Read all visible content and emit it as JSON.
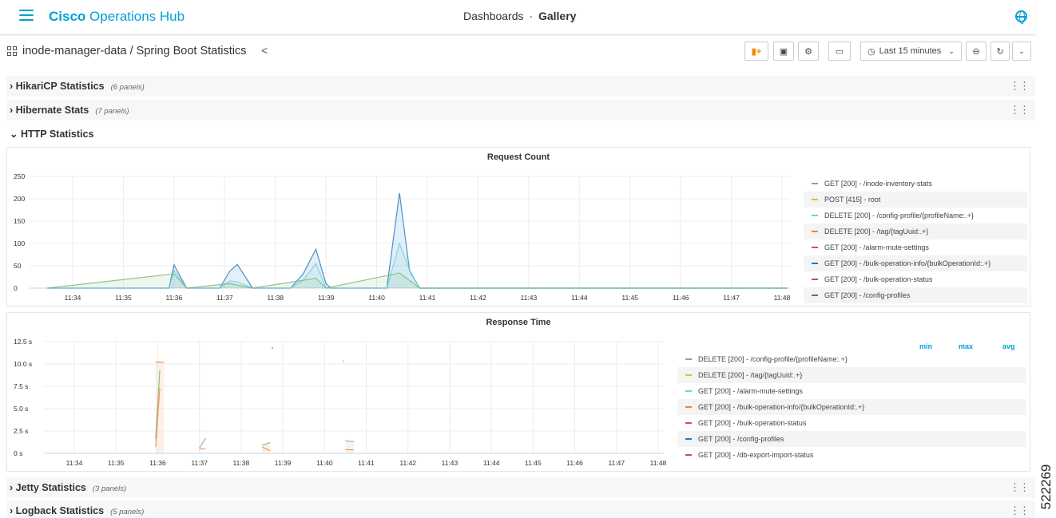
{
  "header": {
    "brand_bold": "Cisco",
    "brand_rest": " Operations Hub",
    "crumb_parent": "Dashboards",
    "crumb_sep": "·",
    "crumb_current": "Gallery"
  },
  "dashboard": {
    "title": "inode-manager-data / Spring Boot Statistics",
    "time_range": "Last 15 minutes"
  },
  "rows": [
    {
      "title": "HikariCP Statistics",
      "count": "(6 panels)",
      "collapsed": true
    },
    {
      "title": "Hibernate Stats",
      "count": "(7 panels)",
      "collapsed": true
    },
    {
      "title": "HTTP Statistics",
      "count": "",
      "collapsed": false
    },
    {
      "title": "Jetty Statistics",
      "count": "(3 panels)",
      "collapsed": true
    },
    {
      "title": "Logback Statistics",
      "count": "(5 panels)",
      "collapsed": true
    }
  ],
  "request_count": {
    "title": "Request Count",
    "legend": [
      {
        "name": "GET [200] - /inode-inventory-stats",
        "color": "#7eb26d"
      },
      {
        "name": "POST [415] - root",
        "color": "#eab839"
      },
      {
        "name": "DELETE [200] - /config-profile/{profileName:.+}",
        "color": "#6ed0e0"
      },
      {
        "name": "DELETE [200] - /tag/{tagUuid:.+}",
        "color": "#ef843c"
      },
      {
        "name": "GET [200] - /alarm-mute-settings",
        "color": "#e24d42"
      },
      {
        "name": "GET [200] - /bulk-operation-info/{bulkOperationId:.+}",
        "color": "#1f78c1"
      },
      {
        "name": "GET [200] - /bulk-operation-status",
        "color": "#ba43a9"
      },
      {
        "name": "GET [200] - /config-profiles",
        "color": "#705da0"
      }
    ]
  },
  "response_time": {
    "title": "Response Time",
    "legend_headers": [
      "min",
      "max",
      "avg"
    ],
    "legend": [
      {
        "name": "DELETE [200] - /config-profile/{profileName:.+}",
        "color": "#7eb26d"
      },
      {
        "name": "DELETE [200] - /tag/{tagUuid:.+}",
        "color": "#eab839"
      },
      {
        "name": "GET [200] - /alarm-mute-settings",
        "color": "#6ed0e0"
      },
      {
        "name": "GET [200] - /bulk-operation-info/{bulkOperationId:.+}",
        "color": "#ef843c"
      },
      {
        "name": "GET [200] - /bulk-operation-status",
        "color": "#e24d42"
      },
      {
        "name": "GET [200] - /config-profiles",
        "color": "#1f78c1"
      },
      {
        "name": "GET [200] - /db-export-import-status",
        "color": "#ba43a9"
      }
    ]
  },
  "chart_data": [
    {
      "type": "area",
      "title": "Request Count",
      "x": [
        "11:34",
        "11:35",
        "11:36",
        "11:37",
        "11:38",
        "11:39",
        "11:40",
        "11:41",
        "11:42",
        "11:43",
        "11:44",
        "11:45",
        "11:46",
        "11:47",
        "11:48"
      ],
      "ylim": [
        0,
        250
      ],
      "yticks": [
        "0",
        "50",
        "100",
        "150",
        "200",
        "250"
      ],
      "grid": true,
      "legend_position": "right",
      "series": [
        {
          "name": "GET [200] - /bulk-operation-info/{bulkOperationId:.+}",
          "color": "#1f78c1",
          "points": [
            [
              "11:33.5",
              0
            ],
            [
              "11:35.9",
              0
            ],
            [
              "11:36.0",
              52
            ],
            [
              "11:36.25",
              0
            ],
            [
              "11:36.9",
              0
            ],
            [
              "11:37.1",
              38
            ],
            [
              "11:37.25",
              53
            ],
            [
              "11:37.55",
              0
            ],
            [
              "11:38.3",
              0
            ],
            [
              "11:38.55",
              32
            ],
            [
              "11:38.8",
              87
            ],
            [
              "11:39.0",
              10
            ],
            [
              "11:39.1",
              0
            ],
            [
              "11:40.2",
              0
            ],
            [
              "11:40.45",
              213
            ],
            [
              "11:40.65",
              38
            ],
            [
              "11:40.85",
              0
            ],
            [
              "11:48.1",
              0
            ]
          ]
        },
        {
          "name": "DELETE [200] - /config-profile/{profileName:.+}",
          "color": "#6ed0e0",
          "points": [
            [
              "11:33.5",
              0
            ],
            [
              "11:35.9",
              0
            ],
            [
              "11:36.0",
              40
            ],
            [
              "11:36.25",
              0
            ],
            [
              "11:36.9",
              0
            ],
            [
              "11:37.1",
              16
            ],
            [
              "11:37.25",
              14
            ],
            [
              "11:37.55",
              0
            ],
            [
              "11:38.3",
              0
            ],
            [
              "11:38.55",
              18
            ],
            [
              "11:38.8",
              55
            ],
            [
              "11:39.0",
              0
            ],
            [
              "11:40.2",
              0
            ],
            [
              "11:40.45",
              100
            ],
            [
              "11:40.65",
              40
            ],
            [
              "11:40.85",
              0
            ],
            [
              "11:48.1",
              0
            ]
          ]
        },
        {
          "name": "GET [200] - /inode-inventory-stats",
          "color": "#7eb26d",
          "points": [
            [
              "11:33.5",
              0
            ],
            [
              "11:36.0",
              32
            ],
            [
              "11:36.25",
              0
            ],
            [
              "11:37.1",
              10
            ],
            [
              "11:37.55",
              0
            ],
            [
              "11:38.8",
              22
            ],
            [
              "11:39.0",
              0
            ],
            [
              "11:40.45",
              34
            ],
            [
              "11:40.85",
              0
            ],
            [
              "11:48.1",
              0
            ]
          ]
        }
      ]
    },
    {
      "type": "line",
      "title": "Response Time",
      "x": [
        "11:34",
        "11:35",
        "11:36",
        "11:37",
        "11:38",
        "11:39",
        "11:40",
        "11:41",
        "11:42",
        "11:43",
        "11:44",
        "11:45",
        "11:46",
        "11:47",
        "11:48"
      ],
      "ylim": [
        0,
        12.5
      ],
      "yticks": [
        "0 s",
        "2.5 s",
        "5.0 s",
        "7.5 s",
        "10.0 s",
        "12.5 s"
      ],
      "grid": true,
      "legend_position": "right",
      "series": [
        {
          "name": "DELETE [200] - /config-profile/{profileName:.+}",
          "color": "#7eb26d",
          "points": [
            [
              "11:35.95",
              1.6
            ],
            [
              "11:36.05",
              9.3
            ]
          ],
          "extra": [
            [
              [
                "11:37.0",
                0.6
              ],
              [
                "11:37.15",
                1.7
              ]
            ],
            [
              [
                "11:38.5",
                0.9
              ],
              [
                "11:38.7",
                1.2
              ]
            ],
            [
              "__dot",
              [
                "11:38.75",
                11.8
              ]
            ],
            [
              [
                "11:40.5",
                1.4
              ],
              [
                "11:40.7",
                1.3
              ]
            ]
          ]
        },
        {
          "name": "DELETE [200] - /tag/{tagUuid:.+}",
          "color": "#eab839",
          "points": [
            [
              "11:40.45",
              10.3
            ]
          ],
          "extra": []
        },
        {
          "name": "GET [200] - /bulk-operation-info/{bulkOperationId:.+}",
          "color": "#ef843c",
          "points": [
            [
              "11:35.95",
              0.7
            ],
            [
              "11:36.05",
              7.3
            ]
          ],
          "extra": [
            [
              [
                "11:35.95",
                10.2
              ],
              [
                "11:36.15",
                10.2
              ]
            ],
            [
              [
                "11:37.0",
                0.5
              ],
              [
                "11:37.15",
                0.5
              ]
            ],
            [
              [
                "11:38.5",
                0.7
              ],
              [
                "11:38.7",
                0.3
              ]
            ],
            [
              [
                "11:40.5",
                0.4
              ],
              [
                "11:40.7",
                0.4
              ]
            ]
          ]
        }
      ]
    }
  ]
}
